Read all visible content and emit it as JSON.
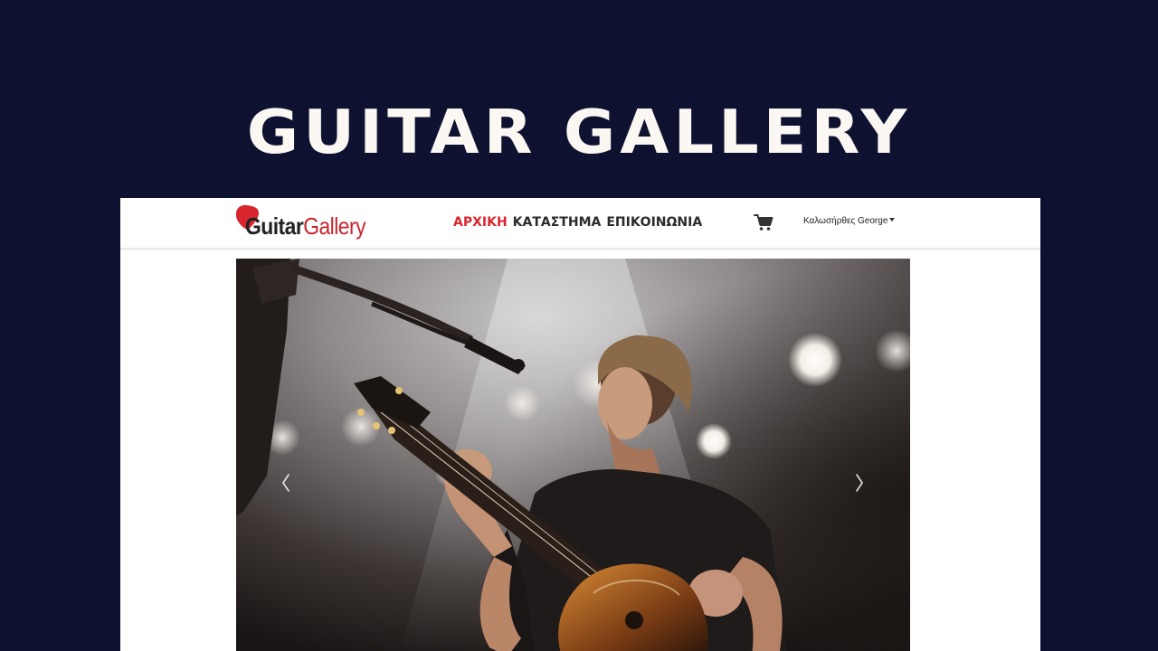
{
  "banner": {
    "title": "GUITAR GALLERY"
  },
  "site": {
    "logo": {
      "part1": "Guitar",
      "part2": "Gallery"
    },
    "nav": {
      "items": [
        {
          "label": "ΑΡΧΙΚΗ",
          "active": true
        },
        {
          "label": "ΚΑΤΑΣΤΗΜΑ",
          "active": false
        },
        {
          "label": "ΕΠΙΚΟΙΝΩΝΙΑ",
          "active": false
        }
      ]
    },
    "cart": {
      "icon": "shopping-cart-icon"
    },
    "user": {
      "greeting": "Καλωσήρθες George"
    },
    "carousel": {
      "image": "guitarist-on-stage-photo",
      "prev_icon": "chevron-left-icon",
      "next_icon": "chevron-right-icon"
    }
  },
  "colors": {
    "background": "#0e1230",
    "accent": "#d9262e",
    "banner_text": "#fbf8f3",
    "nav_text": "#2b2b2b"
  }
}
